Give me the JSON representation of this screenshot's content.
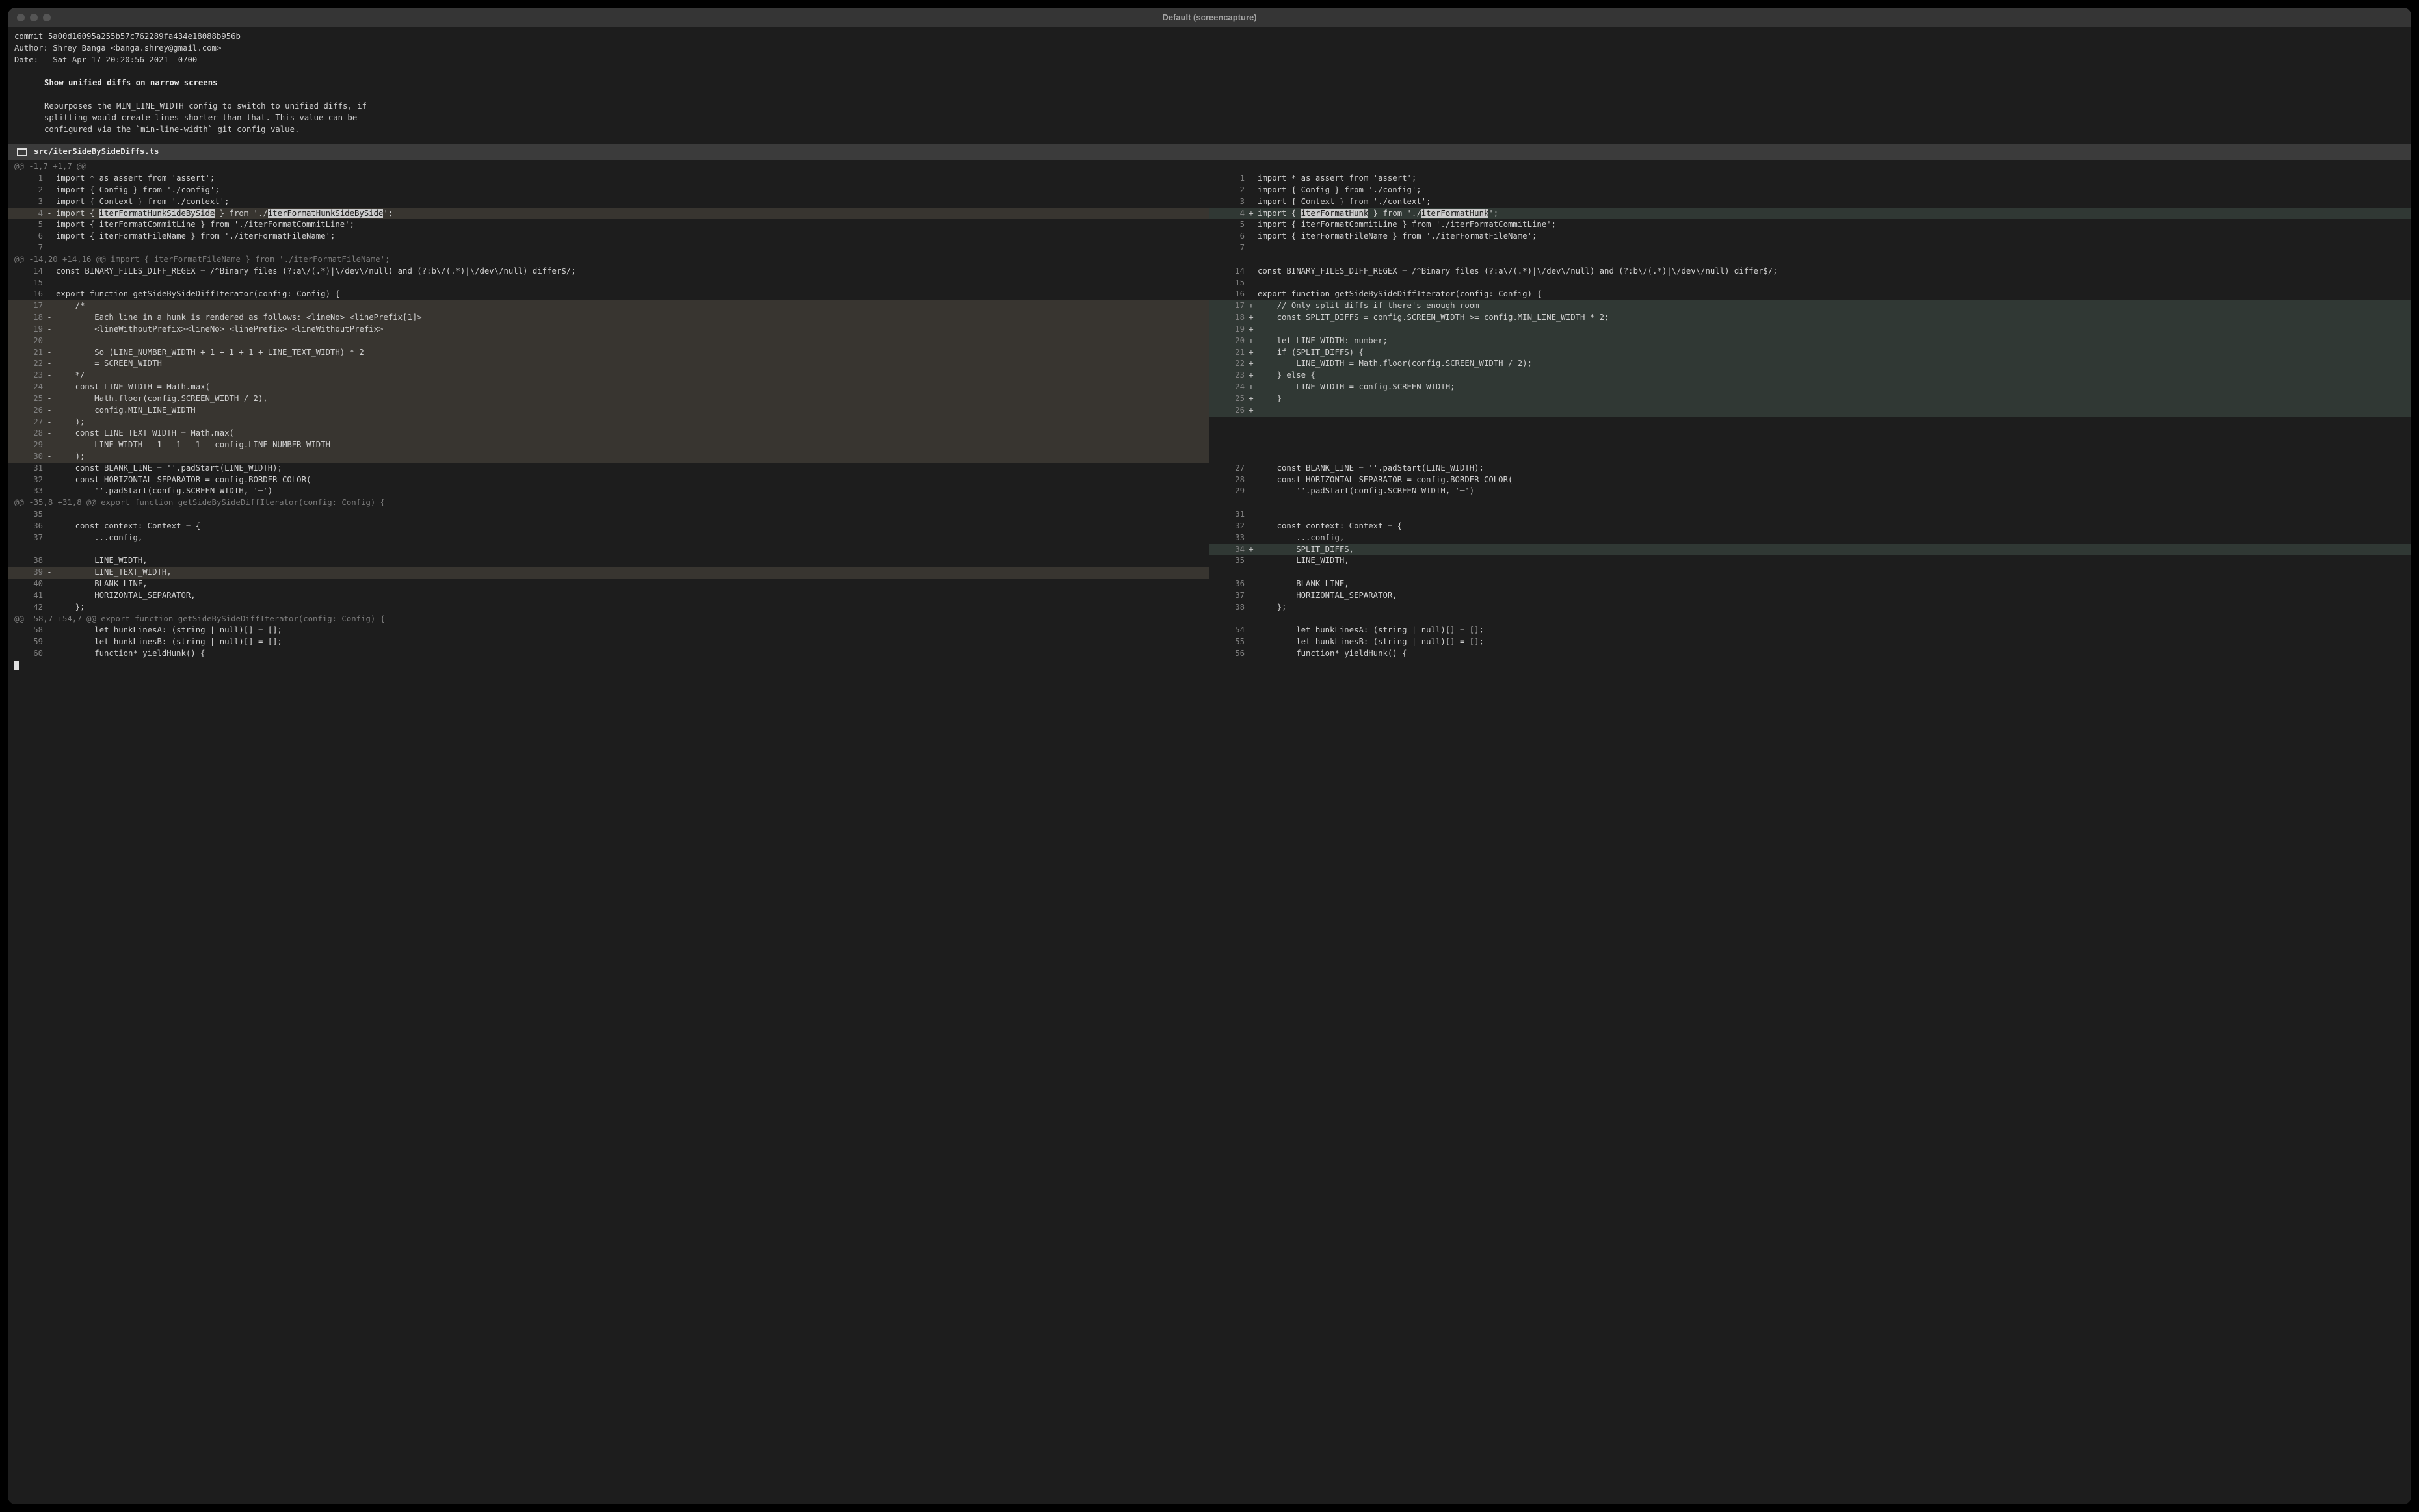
{
  "window": {
    "title": "Default (screencapture)"
  },
  "commit": {
    "hash_line": "commit 5a00d16095a255b57c762289fa434e18088b956b",
    "author_line": "Author: Shrey Banga <banga.shrey@gmail.com>",
    "date_line": "Date:   Sat Apr 17 20:20:56 2021 -0700",
    "subject": "Show unified diffs on narrow screens",
    "body1": "Repurposes the MIN_LINE_WIDTH config to switch to unified diffs, if",
    "body2": "splitting would create lines shorter than that. This value can be",
    "body3": "configured via the `min-line-width` git config value."
  },
  "file": {
    "name": "src/iterSideBySideDiffs.ts"
  },
  "hunks": {
    "h1": "@@ -1,7 +1,7 @@",
    "h2": "@@ -14,20 +14,16 @@ import { iterFormatFileName } from './iterFormatFileName';",
    "h3": "@@ -35,8 +31,8 @@ export function getSideBySideDiffIterator(config: Config) {",
    "h4": "@@ -58,7 +54,7 @@ export function getSideBySideDiffIterator(config: Config) {"
  },
  "L": {
    "r1": {
      "n": "1",
      "s": " ",
      "c": "import * as assert from 'assert';"
    },
    "r2": {
      "n": "2",
      "s": " ",
      "c": "import { Config } from './config';"
    },
    "r3": {
      "n": "3",
      "s": " ",
      "c": "import { Context } from './context';"
    },
    "r4a": {
      "n": "4",
      "s": "-",
      "pre": "import { ",
      "hi1": "iterFormatHunkSideBySide",
      "mid": " } from './",
      "hi2": "iterFormatHunkSideBySide",
      "post": "';"
    },
    "r5": {
      "n": "5",
      "s": " ",
      "c": "import { iterFormatCommitLine } from './iterFormatCommitLine';"
    },
    "r6": {
      "n": "6",
      "s": " ",
      "c": "import { iterFormatFileName } from './iterFormatFileName';"
    },
    "r7": {
      "n": "7",
      "s": " ",
      "c": ""
    },
    "r14": {
      "n": "14",
      "s": " ",
      "c": "const BINARY_FILES_DIFF_REGEX = /^Binary files (?:a\\/(.*)|\\/dev\\/null) and (?:b\\/(.*)|\\/dev\\/null) differ$/;"
    },
    "r15": {
      "n": "15",
      "s": " ",
      "c": ""
    },
    "r16": {
      "n": "16",
      "s": " ",
      "c": "export function getSideBySideDiffIterator(config: Config) {"
    },
    "r17": {
      "n": "17",
      "s": "-",
      "c": "    /*"
    },
    "r18": {
      "n": "18",
      "s": "-",
      "c": "        Each line in a hunk is rendered as follows: <lineNo> <linePrefix[1]>"
    },
    "r19": {
      "n": "19",
      "s": "-",
      "c": "        <lineWithoutPrefix><lineNo> <linePrefix> <lineWithoutPrefix>"
    },
    "r20": {
      "n": "20",
      "s": "-",
      "c": ""
    },
    "r21": {
      "n": "21",
      "s": "-",
      "c": "        So (LINE_NUMBER_WIDTH + 1 + 1 + 1 + LINE_TEXT_WIDTH) * 2"
    },
    "r22": {
      "n": "22",
      "s": "-",
      "c": "        = SCREEN_WIDTH"
    },
    "r23": {
      "n": "23",
      "s": "-",
      "c": "    */"
    },
    "r24": {
      "n": "24",
      "s": "-",
      "c": "    const LINE_WIDTH = Math.max("
    },
    "r25": {
      "n": "25",
      "s": "-",
      "c": "        Math.floor(config.SCREEN_WIDTH / 2),"
    },
    "r26": {
      "n": "26",
      "s": "-",
      "c": "        config.MIN_LINE_WIDTH"
    },
    "r27": {
      "n": "27",
      "s": "-",
      "c": "    );"
    },
    "r28": {
      "n": "28",
      "s": "-",
      "c": "    const LINE_TEXT_WIDTH = Math.max("
    },
    "r29": {
      "n": "29",
      "s": "-",
      "c": "        LINE_WIDTH - 1 - 1 - 1 - config.LINE_NUMBER_WIDTH"
    },
    "r30": {
      "n": "30",
      "s": "-",
      "c": "    );"
    },
    "r31": {
      "n": "31",
      "s": " ",
      "c": "    const BLANK_LINE = ''.padStart(LINE_WIDTH);"
    },
    "r32": {
      "n": "32",
      "s": " ",
      "c": "    const HORIZONTAL_SEPARATOR = config.BORDER_COLOR("
    },
    "r33": {
      "n": "33",
      "s": " ",
      "c": "        ''.padStart(config.SCREEN_WIDTH, '─')"
    },
    "r35": {
      "n": "35",
      "s": " ",
      "c": ""
    },
    "r36": {
      "n": "36",
      "s": " ",
      "c": "    const context: Context = {"
    },
    "r37": {
      "n": "37",
      "s": " ",
      "c": "        ...config,"
    },
    "r38": {
      "n": "38",
      "s": " ",
      "c": "        LINE_WIDTH,"
    },
    "r39": {
      "n": "39",
      "s": "-",
      "c": "        LINE_TEXT_WIDTH,"
    },
    "r40": {
      "n": "40",
      "s": " ",
      "c": "        BLANK_LINE,"
    },
    "r41": {
      "n": "41",
      "s": " ",
      "c": "        HORIZONTAL_SEPARATOR,"
    },
    "r42": {
      "n": "42",
      "s": " ",
      "c": "    };"
    },
    "r58": {
      "n": "58",
      "s": " ",
      "c": "        let hunkLinesA: (string | null)[] = [];"
    },
    "r59": {
      "n": "59",
      "s": " ",
      "c": "        let hunkLinesB: (string | null)[] = [];"
    },
    "r60": {
      "n": "60",
      "s": " ",
      "c": "        function* yieldHunk() {"
    }
  },
  "R": {
    "r1": {
      "n": "1",
      "s": " ",
      "c": "import * as assert from 'assert';"
    },
    "r2": {
      "n": "2",
      "s": " ",
      "c": "import { Config } from './config';"
    },
    "r3": {
      "n": "3",
      "s": " ",
      "c": "import { Context } from './context';"
    },
    "r4a": {
      "n": "4",
      "s": "+",
      "pre": "import { ",
      "hi1": "iterFormatHunk",
      "mid": " } from './",
      "hi2": "iterFormatHunk",
      "post": "';"
    },
    "r5": {
      "n": "5",
      "s": " ",
      "c": "import { iterFormatCommitLine } from './iterFormatCommitLine';"
    },
    "r6": {
      "n": "6",
      "s": " ",
      "c": "import { iterFormatFileName } from './iterFormatFileName';"
    },
    "r7": {
      "n": "7",
      "s": " ",
      "c": ""
    },
    "r14": {
      "n": "14",
      "s": " ",
      "c": "const BINARY_FILES_DIFF_REGEX = /^Binary files (?:a\\/(.*)|\\/dev\\/null) and (?:b\\/(.*)|\\/dev\\/null) differ$/;"
    },
    "r15": {
      "n": "15",
      "s": " ",
      "c": ""
    },
    "r16": {
      "n": "16",
      "s": " ",
      "c": "export function getSideBySideDiffIterator(config: Config) {"
    },
    "r17": {
      "n": "17",
      "s": "+",
      "c": "    // Only split diffs if there's enough room"
    },
    "r18": {
      "n": "18",
      "s": "+",
      "c": "    const SPLIT_DIFFS = config.SCREEN_WIDTH >= config.MIN_LINE_WIDTH * 2;"
    },
    "r19": {
      "n": "19",
      "s": "+",
      "c": ""
    },
    "r20": {
      "n": "20",
      "s": "+",
      "c": "    let LINE_WIDTH: number;"
    },
    "r21": {
      "n": "21",
      "s": "+",
      "c": "    if (SPLIT_DIFFS) {"
    },
    "r22": {
      "n": "22",
      "s": "+",
      "c": "        LINE_WIDTH = Math.floor(config.SCREEN_WIDTH / 2);"
    },
    "r23": {
      "n": "23",
      "s": "+",
      "c": "    } else {"
    },
    "r24": {
      "n": "24",
      "s": "+",
      "c": "        LINE_WIDTH = config.SCREEN_WIDTH;"
    },
    "r25": {
      "n": "25",
      "s": "+",
      "c": "    }"
    },
    "r26": {
      "n": "26",
      "s": "+",
      "c": ""
    },
    "r27": {
      "n": "27",
      "s": " ",
      "c": "    const BLANK_LINE = ''.padStart(LINE_WIDTH);"
    },
    "r28": {
      "n": "28",
      "s": " ",
      "c": "    const HORIZONTAL_SEPARATOR = config.BORDER_COLOR("
    },
    "r29": {
      "n": "29",
      "s": " ",
      "c": "        ''.padStart(config.SCREEN_WIDTH, '─')"
    },
    "r31": {
      "n": "31",
      "s": " ",
      "c": ""
    },
    "r32": {
      "n": "32",
      "s": " ",
      "c": "    const context: Context = {"
    },
    "r33": {
      "n": "33",
      "s": " ",
      "c": "        ...config,"
    },
    "r34": {
      "n": "34",
      "s": "+",
      "c": "        SPLIT_DIFFS,"
    },
    "r35": {
      "n": "35",
      "s": " ",
      "c": "        LINE_WIDTH,"
    },
    "r36": {
      "n": "36",
      "s": " ",
      "c": "        BLANK_LINE,"
    },
    "r37": {
      "n": "37",
      "s": " ",
      "c": "        HORIZONTAL_SEPARATOR,"
    },
    "r38": {
      "n": "38",
      "s": " ",
      "c": "    };"
    },
    "r54": {
      "n": "54",
      "s": " ",
      "c": "        let hunkLinesA: (string | null)[] = [];"
    },
    "r55": {
      "n": "55",
      "s": " ",
      "c": "        let hunkLinesB: (string | null)[] = [];"
    },
    "r56": {
      "n": "56",
      "s": " ",
      "c": "        function* yieldHunk() {"
    }
  }
}
